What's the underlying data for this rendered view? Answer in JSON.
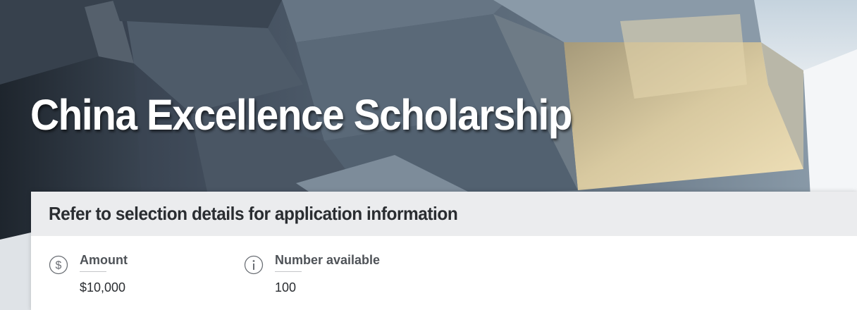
{
  "page": {
    "title": "China Excellence Scholarship"
  },
  "card": {
    "header": "Refer to selection details for application information",
    "facts": [
      {
        "icon": "dollar-circle-icon",
        "label": "Amount",
        "value": "$10,000"
      },
      {
        "icon": "info-circle-icon",
        "label": "Number available",
        "value": "100"
      }
    ]
  },
  "colors": {
    "card_header_bg": "#ebecee",
    "text_dark": "#2a2d31",
    "label_gray": "#4f5358"
  }
}
